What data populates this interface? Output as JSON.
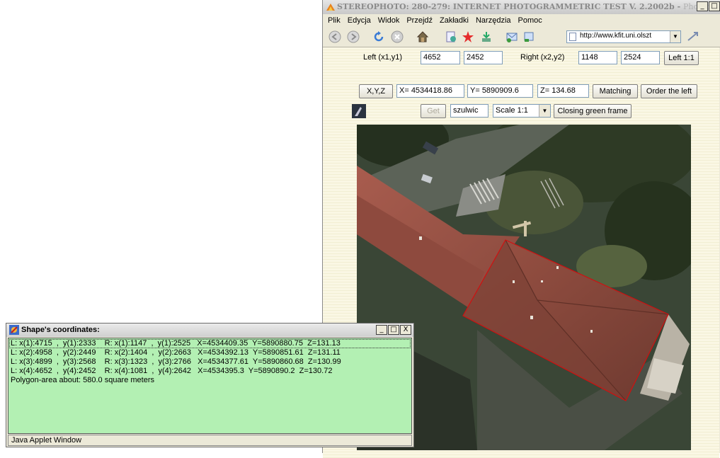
{
  "browser": {
    "title": "STEREOPHOTO: 280-279: INTERNET PHOTOGRAMMETRIC TEST V. 2.2002b - ",
    "app_name": "Phoenix",
    "window_buttons": [
      "_",
      "□",
      "X"
    ],
    "menu": [
      "Plik",
      "Edycja",
      "Widok",
      "Przejdź",
      "Zakładki",
      "Narzędzia",
      "Pomoc"
    ],
    "url": "http://www.kfit.uni.olszt",
    "toolbar_icons": [
      "back-icon",
      "forward-icon",
      "reload-icon",
      "stop-icon",
      "home-icon",
      "bookmark-icon",
      "star-icon",
      "download-icon",
      "mail-icon",
      "print-icon",
      "page-icon",
      "send-icon"
    ]
  },
  "form": {
    "left_label": "Left  (x1,y1)",
    "left_x": "4652",
    "left_y": "2452",
    "right_label": "Right  (x2,y2)",
    "right_x": "1148",
    "right_y": "2524",
    "left_1_1_btn": "Left 1:1",
    "xyz_btn": "X,Y,Z",
    "x_value": "X= 4534418.86",
    "y_value": "Y= 5890909.6",
    "z_value": "Z= 134.68",
    "matching_btn": "Matching",
    "order_left_btn": "Order the left",
    "get_btn": "Get",
    "user_field": "szulwic",
    "scale_select": "Scale 1:1",
    "closing_frame_btn": "Closing green frame"
  },
  "applet": {
    "title": "Shape's coordinates:",
    "window_buttons": [
      "_",
      "□",
      "X"
    ],
    "rows": [
      "L: x(1):4715  ,  y(1):2333    R: x(1):1147  ,  y(1):2525   X=4534409.35  Y=5890880.75  Z=131.13",
      "L: x(2):4958  ,  y(2):2449    R: x(2):1404  ,  y(2):2663   X=4534392.13  Y=5890851.61  Z=131.11",
      "L: x(3):4899  ,  y(3):2568    R: x(3):1323  ,  y(3):2766   X=4534377.61  Y=5890860.68  Z=130.99",
      "L: x(4):4652  ,  y(4):2452    R: x(4):1081  ,  y(4):2642   X=4534395.3  Y=5890890.2  Z=130.72",
      "Polygon-area about: 580.0 square meters"
    ],
    "status": "Java Applet Window"
  },
  "colors": {
    "applet_list_bg": "#b3f0b3",
    "page_bg": "#faf7e4",
    "polygon_line": "#d01010"
  }
}
